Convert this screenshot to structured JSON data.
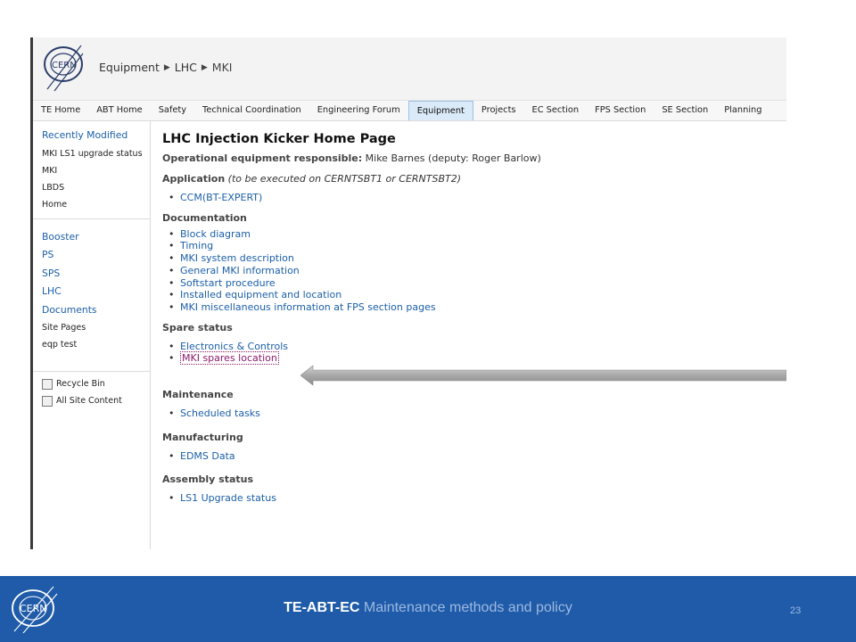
{
  "breadcrumb": {
    "items": [
      "Equipment",
      "LHC",
      "MKI"
    ]
  },
  "topnav": {
    "items": [
      "TE Home",
      "ABT Home",
      "Safety",
      "Technical Coordination",
      "Engineering Forum",
      "Equipment",
      "Projects",
      "EC Section",
      "FPS Section",
      "SE Section",
      "Planning"
    ],
    "active": "Equipment"
  },
  "sidebar": {
    "recent_title": "Recently Modified",
    "recent_items": [
      "MKI LS1 upgrade status",
      "MKI",
      "LBDS",
      "Home"
    ],
    "nav_items": [
      "Booster",
      "PS",
      "SPS",
      "LHC",
      "Documents"
    ],
    "misc_items": [
      "Site Pages",
      "eqp test"
    ],
    "bottom_items": [
      "Recycle Bin",
      "All Site Content"
    ]
  },
  "main": {
    "title": "LHC Injection Kicker Home Page",
    "responsible_label": "Operational equipment responsible:",
    "responsible_value": "Mike Barnes (deputy: Roger Barlow)",
    "application_label": "Application",
    "application_note": "(to be executed on CERNTSBT1 or CERNTSBT2)",
    "application_links": [
      "CCM(BT-EXPERT)"
    ],
    "documentation_label": "Documentation",
    "documentation_links": [
      "Block diagram",
      "Timing",
      "MKI system description",
      "General MKI information",
      "Softstart procedure",
      "Installed equipment and location",
      "MKI miscellaneous information at FPS section pages"
    ],
    "spare_label": "Spare status",
    "spare_links": [
      "Electronics & Controls",
      "MKI spares location"
    ],
    "maintenance_label": "Maintenance",
    "maintenance_links": [
      "Scheduled tasks"
    ],
    "manufacturing_label": "Manufacturing",
    "manufacturing_links": [
      "EDMS Data"
    ],
    "assembly_label": "Assembly status",
    "assembly_links": [
      "LS1 Upgrade status"
    ]
  },
  "footer": {
    "bold": "TE-ABT-EC",
    "normal": "Maintenance methods and policy",
    "page_number": "23",
    "bg_color": "#1f5ba9"
  }
}
